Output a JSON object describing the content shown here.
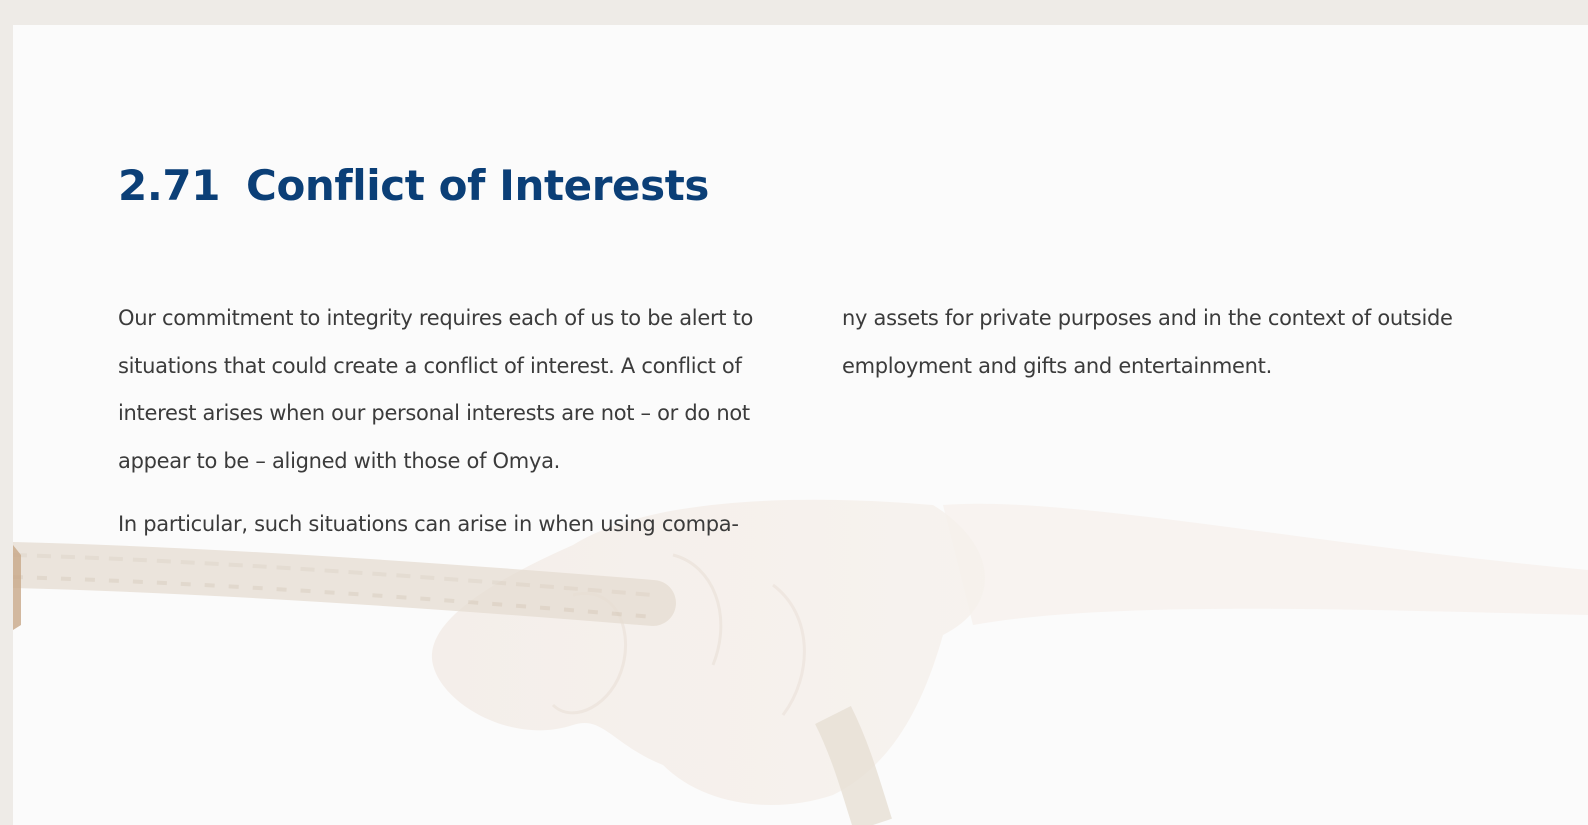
{
  "section": {
    "number": "2.71",
    "title": "Conflict of Interests"
  },
  "body": {
    "column1": {
      "paragraph1": "Our commitment to integrity requires each of us to be alert to situations that could create a conflict of interest. A conflict of interest arises when our personal interests are not – or do not appear to be – aligned with those of Omya.",
      "paragraph2": "In particular, such situations can arise in when using compa-"
    },
    "column2": {
      "paragraph1": "ny assets for private purposes and in the context of outside employment and gifts and entertainment."
    }
  },
  "background": {
    "page_color": "#fbfbfb",
    "frame_color": "#eeebe7",
    "heading_color": "#0b3f77",
    "text_color": "#3b3b3b"
  }
}
